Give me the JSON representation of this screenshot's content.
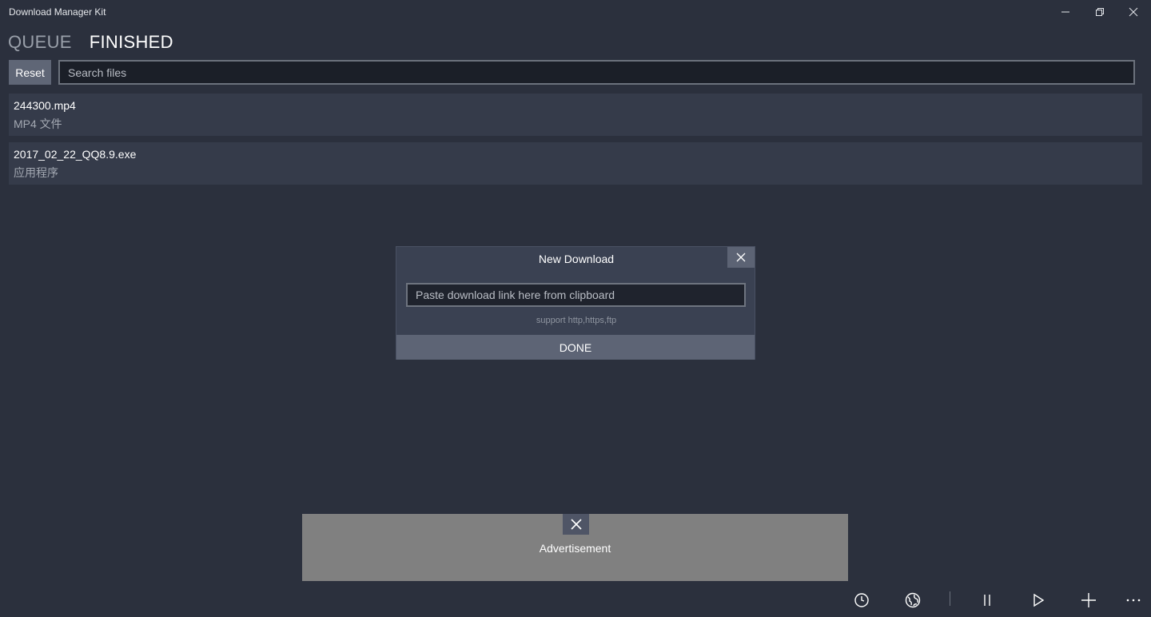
{
  "window": {
    "title": "Download Manager Kit",
    "controls": [
      "minimize-icon",
      "restore-icon",
      "close-icon"
    ]
  },
  "tabs": [
    {
      "label": "QUEUE",
      "active": false
    },
    {
      "label": "FINISHED",
      "active": true
    }
  ],
  "toolbar": {
    "reset_label": "Reset",
    "search_placeholder": "Search files"
  },
  "files": [
    {
      "name": "244300.mp4",
      "type": "MP4 文件"
    },
    {
      "name": "2017_02_22_QQ8.9.exe",
      "type": "应用程序"
    }
  ],
  "dialog": {
    "title": "New Download",
    "input_placeholder": "Paste download link here from clipboard",
    "hint": "support http,https,ftp",
    "done_label": "DONE"
  },
  "ad": {
    "label": "Advertisement"
  },
  "command_bar": {
    "icons": [
      "clock-icon",
      "globe-icon",
      "pause-icon",
      "play-icon",
      "add-icon",
      "more-icon"
    ]
  },
  "colors": {
    "background": "#2b303d",
    "row": "#353b4a",
    "dialog": "#3a4152",
    "button": "#5d6475",
    "ad": "#808080"
  }
}
